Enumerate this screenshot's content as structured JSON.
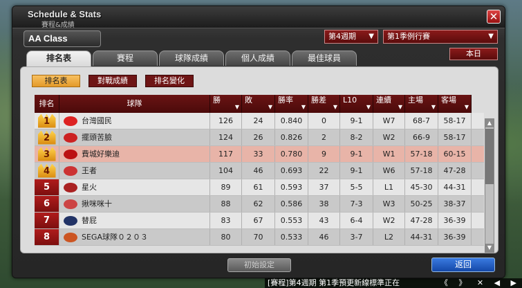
{
  "window": {
    "title_en": "Schedule & Stats",
    "title_zh": "賽程&成績",
    "close_label": "✕"
  },
  "class_label": "AA Class",
  "dropdowns": {
    "week": "第4週期",
    "season": "第1季例行賽"
  },
  "today_button": "本日",
  "tabs": [
    {
      "label": "排名表",
      "active": true
    },
    {
      "label": "賽程",
      "active": false
    },
    {
      "label": "球隊成績",
      "active": false
    },
    {
      "label": "個人成績",
      "active": false
    },
    {
      "label": "最佳球員",
      "active": false
    }
  ],
  "subtabs": [
    {
      "label": "排名表",
      "active": true
    },
    {
      "label": "對戰成績",
      "active": false
    },
    {
      "label": "排名變化",
      "active": false
    }
  ],
  "table": {
    "headers": [
      "排名",
      "球隊",
      "勝",
      "敗",
      "勝率",
      "勝差",
      "L10",
      "連續",
      "主場",
      "客場"
    ],
    "rows": [
      {
        "rank": "1",
        "team": "台灣國民",
        "w": "126",
        "l": "24",
        "pct": "0.840",
        "gb": "0",
        "l10": "9-1",
        "streak": "W7",
        "home": "68-7",
        "away": "58-17",
        "logo": "#d22",
        "style": "norm"
      },
      {
        "rank": "2",
        "team": "擺頭苦臉",
        "w": "124",
        "l": "26",
        "pct": "0.826",
        "gb": "2",
        "l10": "8-2",
        "streak": "W2",
        "home": "66-9",
        "away": "58-17",
        "logo": "#c22",
        "style": "alt"
      },
      {
        "rank": "3",
        "team": "費城好樂迪",
        "w": "117",
        "l": "33",
        "pct": "0.780",
        "gb": "9",
        "l10": "9-1",
        "streak": "W1",
        "home": "57-18",
        "away": "60-15",
        "logo": "#b11",
        "style": "hl"
      },
      {
        "rank": "4",
        "team": "王者",
        "w": "104",
        "l": "46",
        "pct": "0.693",
        "gb": "22",
        "l10": "9-1",
        "streak": "W6",
        "home": "57-18",
        "away": "47-28",
        "logo": "#c33",
        "style": "alt"
      },
      {
        "rank": "5",
        "team": "星火",
        "w": "89",
        "l": "61",
        "pct": "0.593",
        "gb": "37",
        "l10": "5-5",
        "streak": "L1",
        "home": "45-30",
        "away": "44-31",
        "logo": "#a22",
        "style": "norm"
      },
      {
        "rank": "6",
        "team": "揪咪咪十",
        "w": "88",
        "l": "62",
        "pct": "0.586",
        "gb": "38",
        "l10": "7-3",
        "streak": "W3",
        "home": "50-25",
        "away": "38-37",
        "logo": "#c44",
        "style": "alt"
      },
      {
        "rank": "7",
        "team": "替屁",
        "w": "83",
        "l": "67",
        "pct": "0.553",
        "gb": "43",
        "l10": "6-4",
        "streak": "W2",
        "home": "47-28",
        "away": "36-39",
        "logo": "#236",
        "style": "norm"
      },
      {
        "rank": "8",
        "team": "SEGA球隊０２０３",
        "w": "80",
        "l": "70",
        "pct": "0.533",
        "gb": "46",
        "l10": "3-7",
        "streak": "L2",
        "home": "44-31",
        "away": "36-39",
        "logo": "#c52",
        "style": "alt"
      }
    ]
  },
  "buttons": {
    "reset": "初始設定",
    "back": "返回"
  },
  "ticker": {
    "text": "[賽程]第4週期 第1季預更新線標準正在",
    "controls": "《 》 ✕ ◀ ▶"
  }
}
